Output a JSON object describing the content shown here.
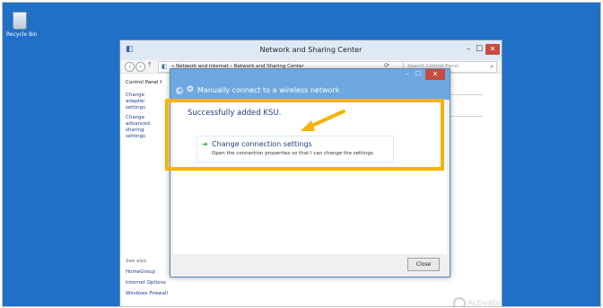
{
  "desktop": {
    "recycle_bin_label": "Recycle Bin"
  },
  "nsc_window": {
    "title": "Network and Sharing Center",
    "minimize": "–",
    "maximize": "☐",
    "close": "✕",
    "breadcrumb": "« Network and Internet › Network and Sharing Center",
    "search_placeholder": "Search Control Panel",
    "left_pane": {
      "title": "Control Panel Home",
      "links": [
        "Change adapter settings",
        "Change advanced sharing settings"
      ]
    },
    "see_also": {
      "heading": "See also",
      "links": [
        "HomeGroup",
        "Internet Options",
        "Windows Firewall"
      ]
    }
  },
  "dialog": {
    "header": "Manually connect to a wireless network",
    "success_message": "Successfully added KSU.",
    "option_title": "Change connection settings",
    "option_description": "Open the connection properties so that I can change the settings.",
    "close_button": "Close",
    "minimize": "–",
    "maximize": "☐",
    "close": "✕"
  },
  "watermark": {
    "text": "Activate"
  },
  "colors": {
    "desktop": "#2070c8",
    "highlight": "#f5b400",
    "dialog_header": "#6da8e0",
    "close_button": "#c74b3f"
  }
}
